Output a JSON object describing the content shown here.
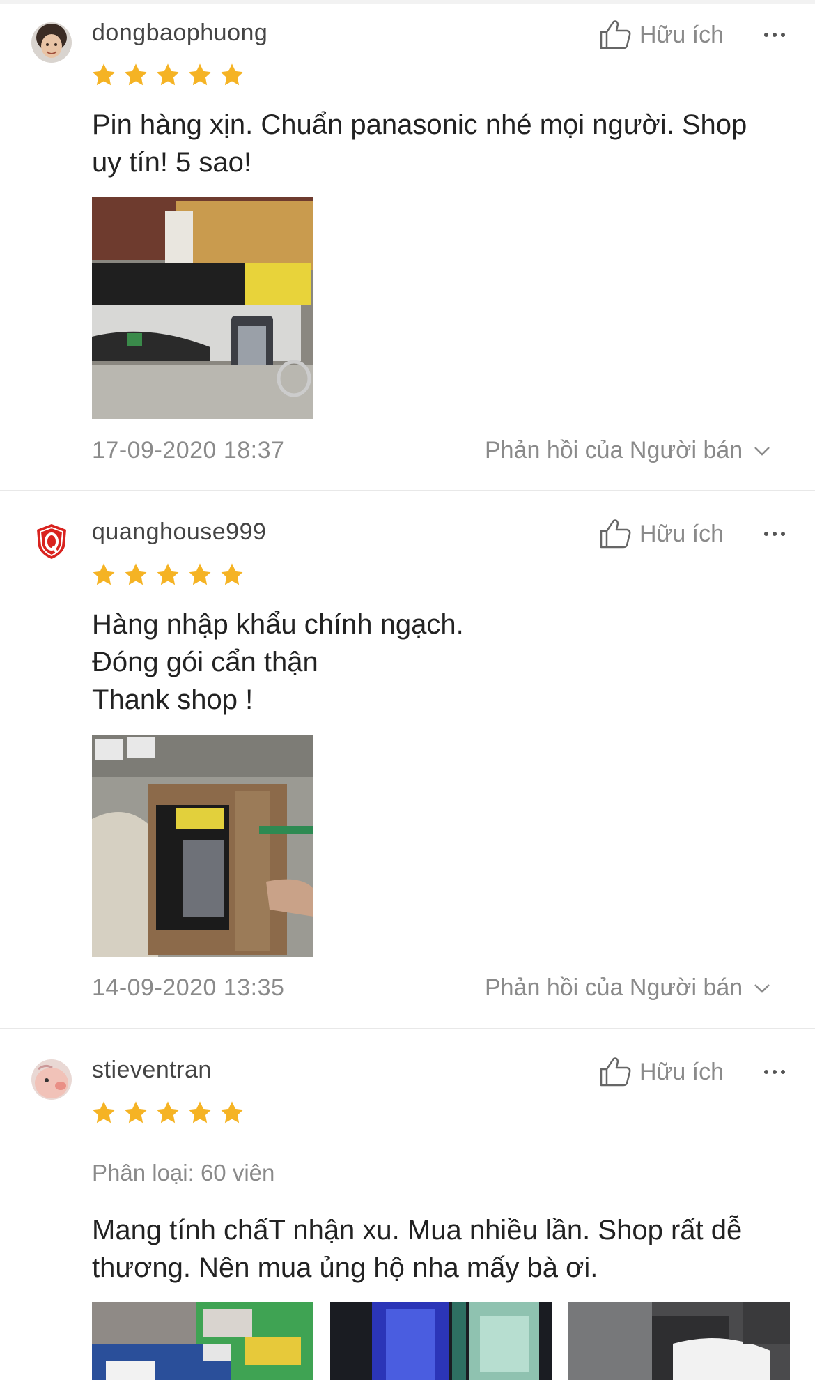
{
  "labels": {
    "helpful": "Hữu ích",
    "seller_reply": "Phản hồi của Người bán"
  },
  "colors": {
    "star": "#F5B324",
    "muted": "#8A8A8A",
    "separator": "#E8E8E8"
  },
  "reviews": [
    {
      "username": "dongbaophuong",
      "rating": 5,
      "text_lines": [
        "Pin hàng xịn. Chuẩn panasonic nhé mọi người. Shop",
        "uy tín! 5 sao!"
      ],
      "date": "17-09-2020 18:37"
    },
    {
      "username": "quanghouse999",
      "rating": 5,
      "text_lines": [
        "Hàng nhập khẩu chính ngạch.",
        "Đóng gói cẩn thận",
        "Thank shop !"
      ],
      "date": "14-09-2020 13:35"
    },
    {
      "username": "stieventran",
      "rating": 5,
      "variant": "Phân loại: 60 viên",
      "text_lines": [
        "Mang tính chấT nhận xu. Mua nhiều lần. Shop rất dễ",
        "thương. Nên mua ủng hộ nha mấy bà ơi."
      ]
    }
  ]
}
